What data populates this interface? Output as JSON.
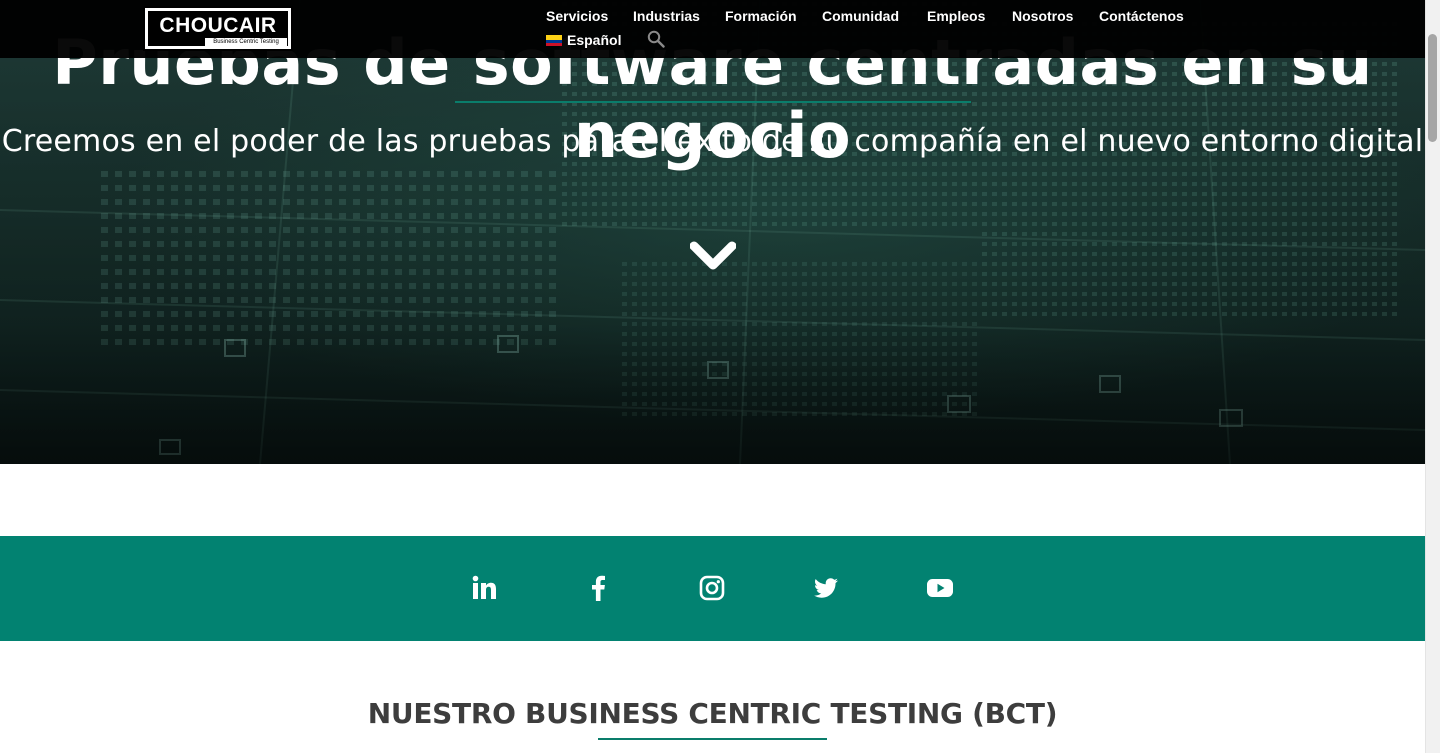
{
  "header": {
    "logo_text": "CHOUCAIR",
    "logo_tagline": "Business Centric Testing",
    "nav": [
      {
        "label": "Servicios"
      },
      {
        "label": "Industrias"
      },
      {
        "label": "Formación"
      },
      {
        "label": "Comunidad"
      },
      {
        "label": "Empleos"
      },
      {
        "label": "Nosotros"
      },
      {
        "label": "Contáctenos"
      }
    ],
    "language": "Español",
    "language_flag_colors": [
      "#fcd116",
      "#003893",
      "#ce1126"
    ],
    "search_icon": "search-icon"
  },
  "hero": {
    "title": "Pruebas de software centradas en su negocio",
    "subtitle": "Creemos en el poder de las pruebas para el éxito de su compañía en el nuevo entorno digital",
    "scroll_icon": "chevron-down-icon",
    "accent_color": "#0a7d6b"
  },
  "social": {
    "background_color": "#028271",
    "icons": [
      "linkedin-icon",
      "facebook-icon",
      "instagram-icon",
      "twitter-icon",
      "youtube-icon"
    ]
  },
  "section": {
    "heading": "NUESTRO BUSINESS CENTRIC TESTING (BCT)"
  }
}
